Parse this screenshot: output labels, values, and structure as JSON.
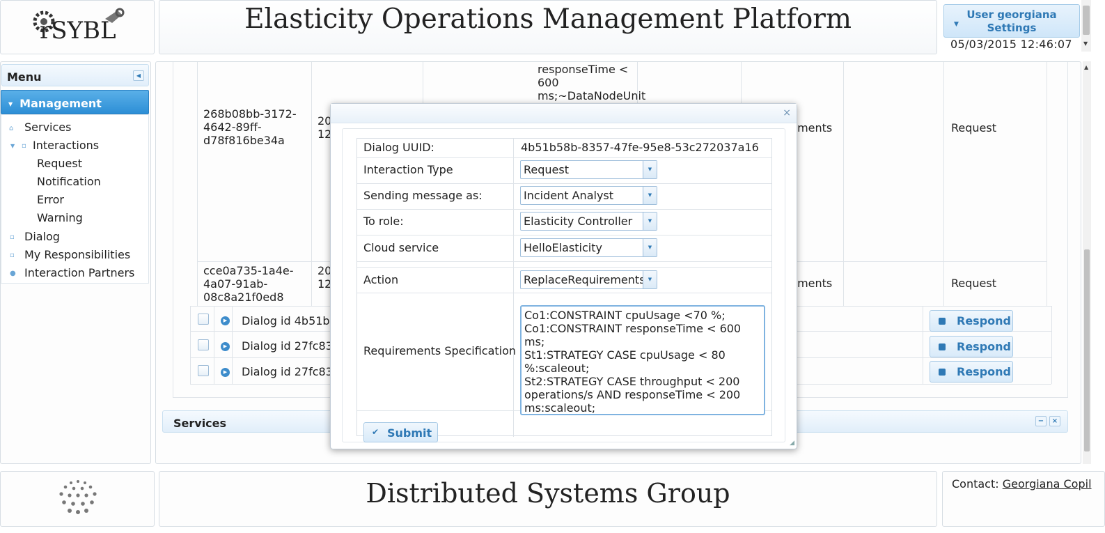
{
  "header": {
    "logo_text": "rSYBL",
    "title": "Elasticity Operations Management Platform",
    "user_button_line1": "User georgiana",
    "user_button_line2": "Settings",
    "datetime": "05/03/2015 12:46:07"
  },
  "menu": {
    "title": "Menu",
    "active_section": "Management",
    "items": [
      {
        "label": "Services"
      },
      {
        "label": "Interactions"
      },
      {
        "label": "Request"
      },
      {
        "label": "Notification"
      },
      {
        "label": "Error"
      },
      {
        "label": "Warning"
      },
      {
        "label": "Dialog"
      },
      {
        "label": "My Responsibilities"
      },
      {
        "label": "Interaction Partners"
      }
    ]
  },
  "table": {
    "rows": [
      {
        "id_lines": [
          "268b08bb-3172-",
          "4642-89ff-",
          "d78f816be34a"
        ],
        "date_lines": [
          "20",
          "12"
        ],
        "content_lines": [
          "responseTime <",
          "600",
          "ms;~DataNodeUnit"
        ],
        "col5": "rements",
        "type": "Request"
      },
      {
        "id_lines": [
          "cce0a735-1a4e-",
          "4a07-91ab-",
          "08c8a21f0ed8"
        ],
        "date_lines": [
          "20",
          "12"
        ],
        "col5": "rements",
        "type": "Request"
      }
    ],
    "dialog_rows": [
      {
        "label": "Dialog id 4b51b5",
        "action": "Respond"
      },
      {
        "label": "Dialog id 27fc83",
        "action": "Respond"
      },
      {
        "label": "Dialog id 27fc83",
        "action": "Respond"
      }
    ],
    "services_label": "Services"
  },
  "modal": {
    "close_glyph": "×",
    "fields": {
      "dialog_uuid_label": "Dialog UUID:",
      "dialog_uuid_value": "4b51b58b-8357-47fe-95e8-53c272037a16",
      "interaction_type_label": "Interaction Type",
      "interaction_type_value": "Request",
      "sending_as_label": "Sending message as:",
      "sending_as_value": "Incident Analyst",
      "to_role_label": "To role:",
      "to_role_value": "Elasticity Controller",
      "cloud_service_label": "Cloud service",
      "cloud_service_value": "HelloElasticity",
      "action_label": "Action",
      "action_value": "ReplaceRequirements",
      "requirements_label": "Requirements Specification",
      "requirements_value": "Co1:CONSTRAINT cpuUsage <70 %;\nCo1:CONSTRAINT responseTime < 600 ms;\nSt1:STRATEGY CASE cpuUsage < 80\n%:scaleout;\nSt2:STRATEGY CASE throughput < 200\noperations/s AND responseTime < 200\nms:scaleout;"
    },
    "submit_label": "Submit"
  },
  "footer": {
    "title": "Distributed Systems Group",
    "contact_label": "Contact:",
    "contact_name": "Georgiana Copil"
  }
}
